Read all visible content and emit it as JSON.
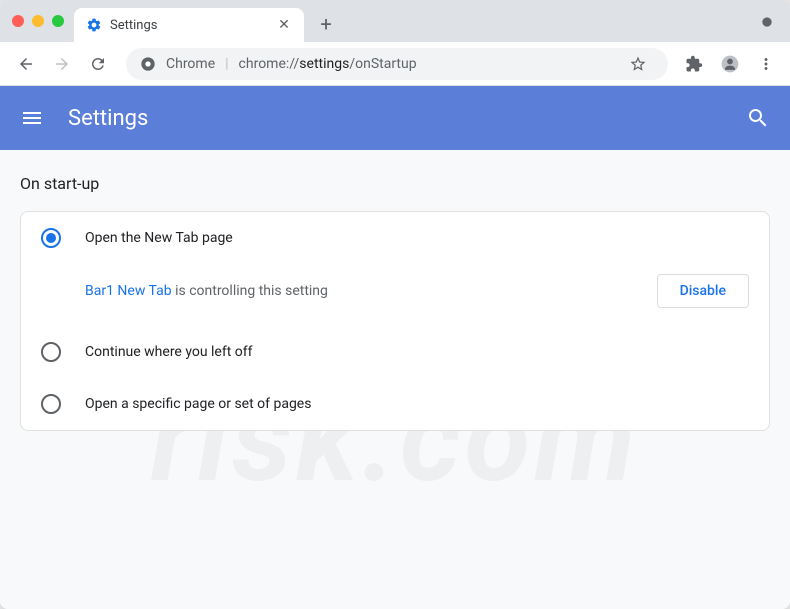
{
  "window": {
    "tab_title": "Settings",
    "url_scheme": "Chrome",
    "url_domain": "chrome://",
    "url_path_strong": "settings",
    "url_path_rest": "/onStartup"
  },
  "header": {
    "title": "Settings"
  },
  "section": {
    "title": "On start-up"
  },
  "options": [
    {
      "label": "Open the New Tab page",
      "checked": true
    },
    {
      "label": "Continue where you left off",
      "checked": false
    },
    {
      "label": "Open a specific page or set of pages",
      "checked": false
    }
  ],
  "notice": {
    "extension_name": "Bar1 New Tab",
    "suffix": " is controlling this setting",
    "button": "Disable"
  }
}
